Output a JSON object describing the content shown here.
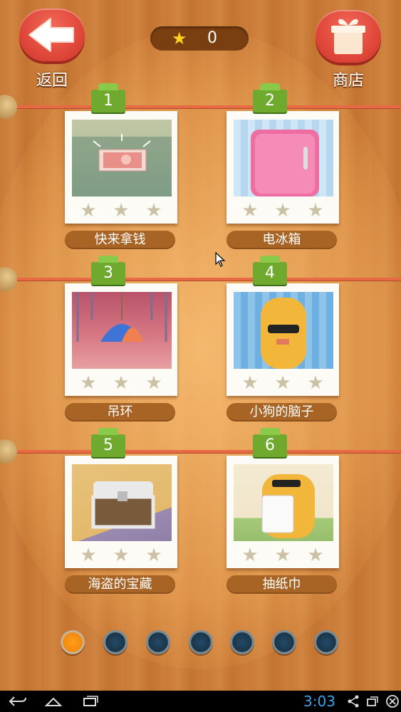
{
  "header": {
    "back_label": "返回",
    "shop_label": "商店",
    "star_count": "0"
  },
  "levels": [
    {
      "number": "1",
      "name": "快来拿钱",
      "stars_earned": 0,
      "stars_total": 3
    },
    {
      "number": "2",
      "name": "电冰箱",
      "stars_earned": 0,
      "stars_total": 3
    },
    {
      "number": "3",
      "name": "吊环",
      "stars_earned": 0,
      "stars_total": 3
    },
    {
      "number": "4",
      "name": "小狗的脑子",
      "stars_earned": 0,
      "stars_total": 3
    },
    {
      "number": "5",
      "name": "海盗的宝藏",
      "stars_earned": 0,
      "stars_total": 3
    },
    {
      "number": "6",
      "name": "抽纸巾",
      "stars_earned": 0,
      "stars_total": 3
    }
  ],
  "pagination": {
    "pages": 7,
    "current_page": 1
  },
  "status_bar": {
    "time": "3:03"
  },
  "icons": {
    "back": "arrow-left-icon",
    "shop": "gift-icon",
    "star": "star-icon",
    "nav_back": "nav-back-icon",
    "nav_home": "nav-home-icon",
    "nav_recents": "nav-recents-icon",
    "share": "share-icon",
    "window": "window-icon",
    "close": "close-icon"
  },
  "colors": {
    "accent_red": "#e0483a",
    "tag_green": "#6faa2e",
    "active_dot": "#f28a10",
    "clock_blue": "#3aa3e8"
  }
}
